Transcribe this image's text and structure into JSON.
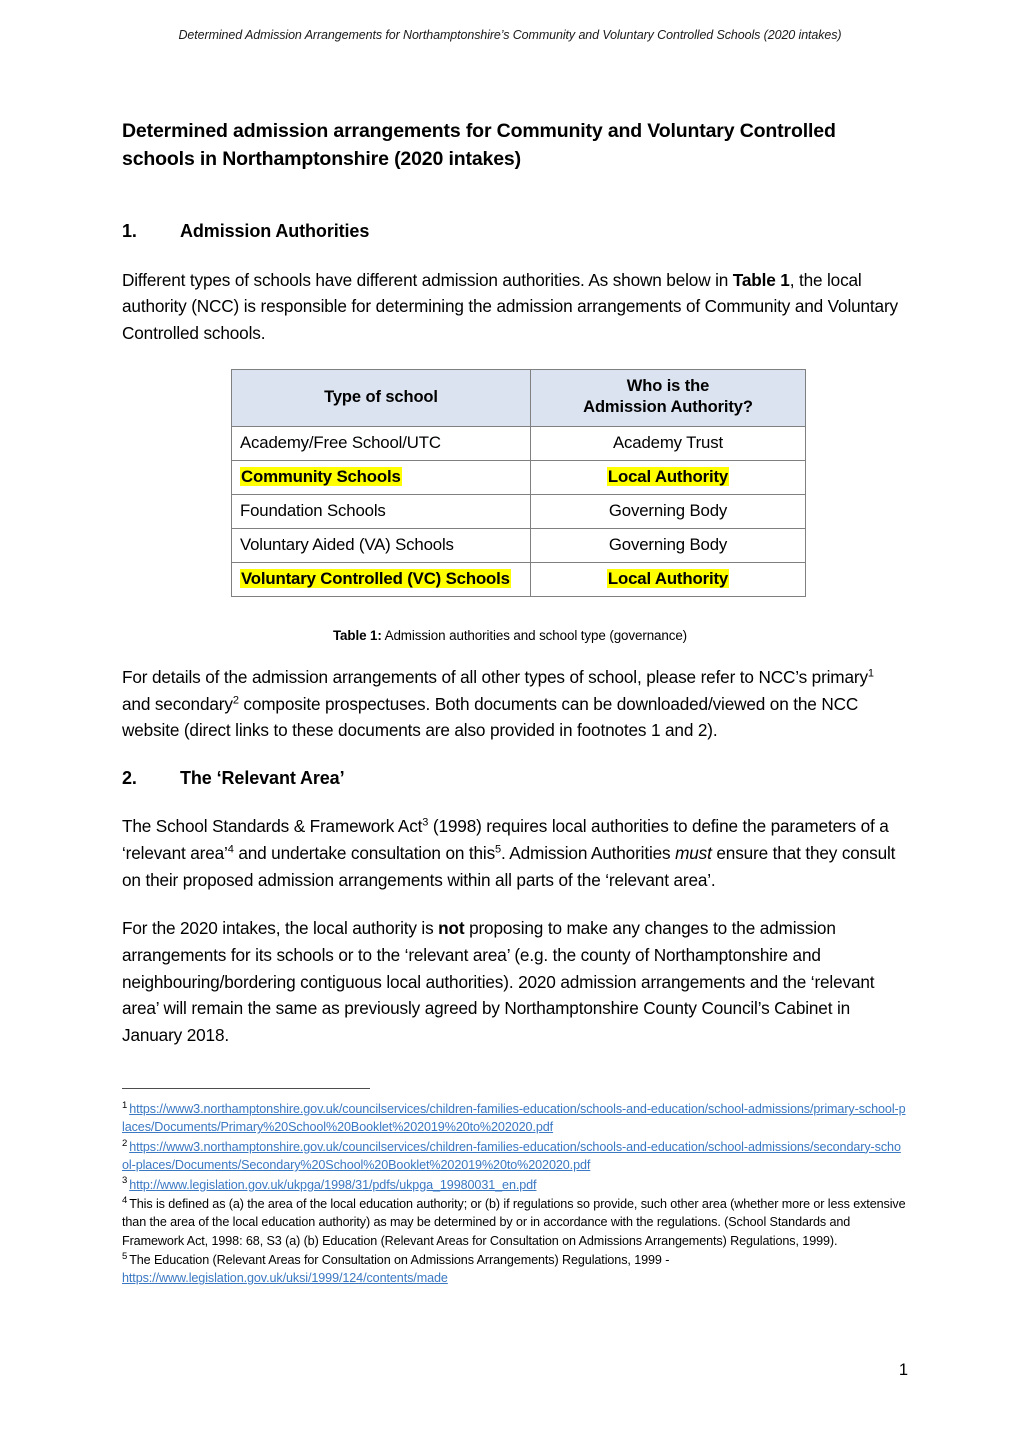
{
  "header": {
    "running_head": "Determined Admission Arrangements for Northamptonshire’s Community and Voluntary Controlled Schools (2020 intakes)"
  },
  "document": {
    "title": "Determined admission arrangements for Community and Voluntary Controlled schools in Northamptonshire (2020 intakes)",
    "page_number": "1"
  },
  "section1": {
    "number": "1.",
    "heading": "Admission Authorities",
    "paragraph_part1": "Different types of schools have different admission authorities. As shown below in ",
    "paragraph_bold": "Table 1",
    "paragraph_part2": ", the local authority (NCC) is responsible for determining the admission arrangements of Community and Voluntary Controlled schools."
  },
  "table": {
    "headers": [
      "Type of school",
      "Who is the\nAdmission Authority?"
    ],
    "header_col1": "Type of school",
    "header_col2_line1": "Who is the",
    "header_col2_line2": "Admission Authority?",
    "header_fill": "#DCE3F0",
    "highlight_color": "#FFFF00",
    "rows": [
      {
        "type": "Academy/Free School/UTC",
        "authority": "Academy Trust",
        "highlighted": false
      },
      {
        "type": "Community Schools",
        "authority": "Local Authority",
        "highlighted": true
      },
      {
        "type": "Foundation Schools",
        "authority": "Governing Body",
        "highlighted": false
      },
      {
        "type": "Voluntary Aided (VA) Schools",
        "authority": "Governing Body",
        "highlighted": false
      },
      {
        "type": "Voluntary Controlled (VC) Schools",
        "authority": "Local Authority",
        "highlighted": true
      }
    ],
    "caption_label": "Table 1:",
    "caption_text": " Admission authorities and school type (governance)"
  },
  "paragraph_after_table": {
    "part1": "For details of the admission arrangements of all other types of school, please refer to NCC’s primary",
    "ref1": "1",
    "part2": " and secondary",
    "ref2": "2",
    "part3": " composite prospectuses. Both documents can be downloaded/viewed on the NCC website (direct links to these documents are also provided in footnotes 1 and 2)."
  },
  "section2": {
    "number": "2.",
    "heading": "The ‘Relevant Area’",
    "para1_part1": "The School Standards & Framework Act",
    "para1_ref3": "3",
    "para1_part2": " (1998) requires local authorities to define the parameters of a ‘relevant area’",
    "para1_ref4": "4",
    "para1_part3": " and undertake consultation on this",
    "para1_ref5": "5",
    "para1_part4": ". Admission Authorities ",
    "para1_italic": "must",
    "para1_part5": " ensure that they consult on their proposed admission arrangements within all parts of the ‘relevant area’.",
    "para2_part1": "For the 2020 intakes, the local authority is ",
    "para2_bold": "not",
    "para2_part2": " proposing to make any changes to the admission arrangements for its schools or to the ‘relevant area’ (e.g. the county of Northamptonshire and neighbouring/bordering contiguous local authorities). 2020 admission arrangements and the ‘relevant area’ will remain the same as previously agreed by Northamptonshire County Council’s Cabinet in January 2018."
  },
  "footnotes": {
    "link_color": "#3B78C3",
    "items": [
      {
        "marker": "1",
        "link": "https://www3.northamptonshire.gov.uk/councilservices/children-families-education/schools-and-education/school-admissions/primary-school-places/Documents/Primary%20School%20Booklet%202019%20to%202020.pdf",
        "text": ""
      },
      {
        "marker": "2",
        "link": "https://www3.northamptonshire.gov.uk/councilservices/children-families-education/schools-and-education/school-admissions/secondary-school-places/Documents/Secondary%20School%20Booklet%202019%20to%202020.pdf",
        "text": ""
      },
      {
        "marker": "3",
        "link": "http://www.legislation.gov.uk/ukpga/1998/31/pdfs/ukpga_19980031_en.pdf",
        "text": ""
      },
      {
        "marker": "4",
        "link": "",
        "text": "This is defined as (a) the area of the local education authority; or (b) if regulations so provide, such other area (whether more or less extensive than the area of the local education authority) as may be determined by or in accordance with the regulations. (School Standards and Framework Act, 1998: 68, S3 (a) (b) Education (Relevant Areas for Consultation on Admissions Arrangements) Regulations, 1999)."
      },
      {
        "marker": "5",
        "link": "https://www.legislation.gov.uk/uksi/1999/124/contents/made",
        "text": "The Education (Relevant Areas for Consultation on Admissions Arrangements) Regulations, 1999 - "
      }
    ]
  }
}
